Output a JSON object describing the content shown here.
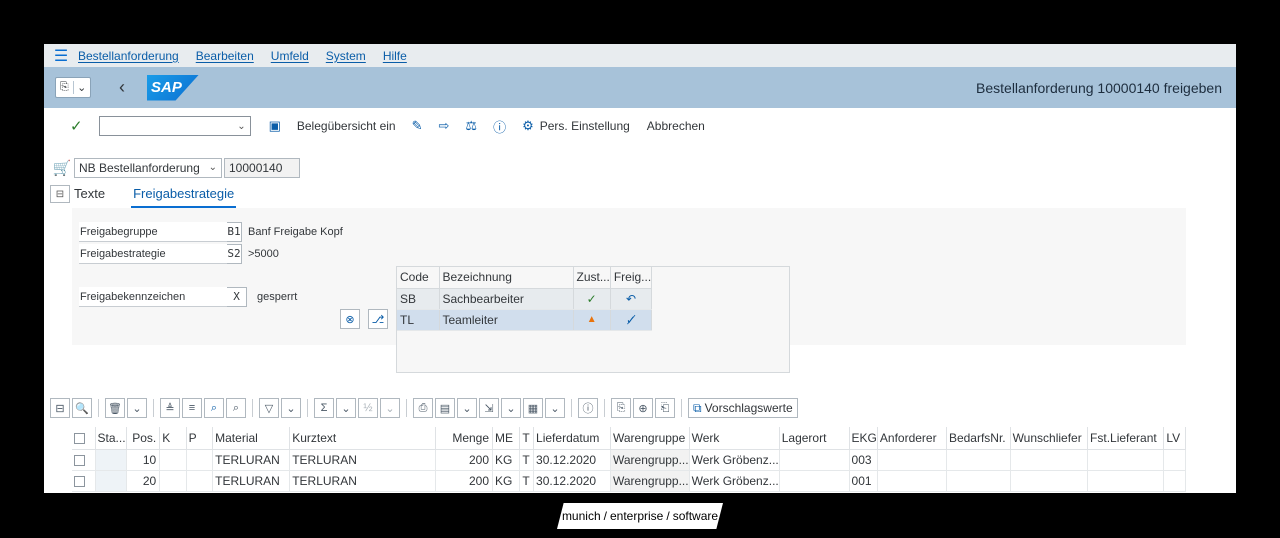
{
  "menu": {
    "items": [
      "Bestellanforderung",
      "Bearbeiten",
      "Umfeld",
      "System",
      "Hilfe"
    ]
  },
  "shell": {
    "logo": "SAP",
    "title": "Bestellanforderung 10000140 freigeben"
  },
  "toolbar": {
    "command_value": "",
    "belegubersicht": "Belegübersicht ein",
    "pers_einstellung": "Pers. Einstellung",
    "abbrechen": "Abbrechen"
  },
  "header": {
    "doc_type": "NB Bestellanforderung",
    "doc_number": "10000140"
  },
  "tabs": [
    "Texte",
    "Freigabestrategie"
  ],
  "release": {
    "group_label": "Freigabegruppe",
    "group_value": "B1",
    "group_desc": "Banf Freigabe Kopf",
    "strategy_label": "Freigabestrategie",
    "strategy_value": "S2",
    "strategy_desc": ">5000",
    "indicator_label": "Freigabekennzeichen",
    "indicator_value": "X",
    "indicator_desc": "gesperrt"
  },
  "strategy_table": {
    "headers": [
      "Code",
      "Bezeichnung",
      "Zust...",
      "Freig..."
    ],
    "rows": [
      {
        "code": "SB",
        "name": "Sachbearbeiter",
        "status": "check",
        "release": "undo"
      },
      {
        "code": "TL",
        "name": "Teamleiter",
        "status": "warning",
        "release": "release"
      }
    ]
  },
  "alv": {
    "vorschlagswerte": "Vorschlagswerte"
  },
  "grid": {
    "headers": [
      "Sta...",
      "Pos.",
      "K",
      "P",
      "Material",
      "Kurztext",
      "Menge",
      "ME",
      "T",
      "Lieferdatum",
      "Warengruppe",
      "Werk",
      "Lagerort",
      "EKG",
      "Anforderer",
      "BedarfsNr.",
      "Wunschliefer",
      "Fst.Lieferant",
      "LV"
    ],
    "rows": [
      {
        "pos": "10",
        "material": "TERLURAN",
        "kurztext": "TERLURAN",
        "menge": "200",
        "me": "KG",
        "t": "T",
        "lieferdatum": "30.12.2020",
        "warengruppe": "Warengrupp...",
        "werk": "Werk Gröbenz...",
        "ekg": "003"
      },
      {
        "pos": "20",
        "material": "TERLURAN",
        "kurztext": "TERLURAN",
        "menge": "200",
        "me": "KG",
        "t": "T",
        "lieferdatum": "30.12.2020",
        "warengruppe": "Warengrupp...",
        "werk": "Werk Gröbenz...",
        "ekg": "001"
      }
    ]
  },
  "footer": {
    "brand_1": "munich",
    "brand_2": "enterprise",
    "brand_3": "software"
  },
  "colors": {
    "shell": "#a7c2d9",
    "accent": "#0a6ed1",
    "ok_green": "#2b7d2b",
    "warning": "#e9730c"
  }
}
